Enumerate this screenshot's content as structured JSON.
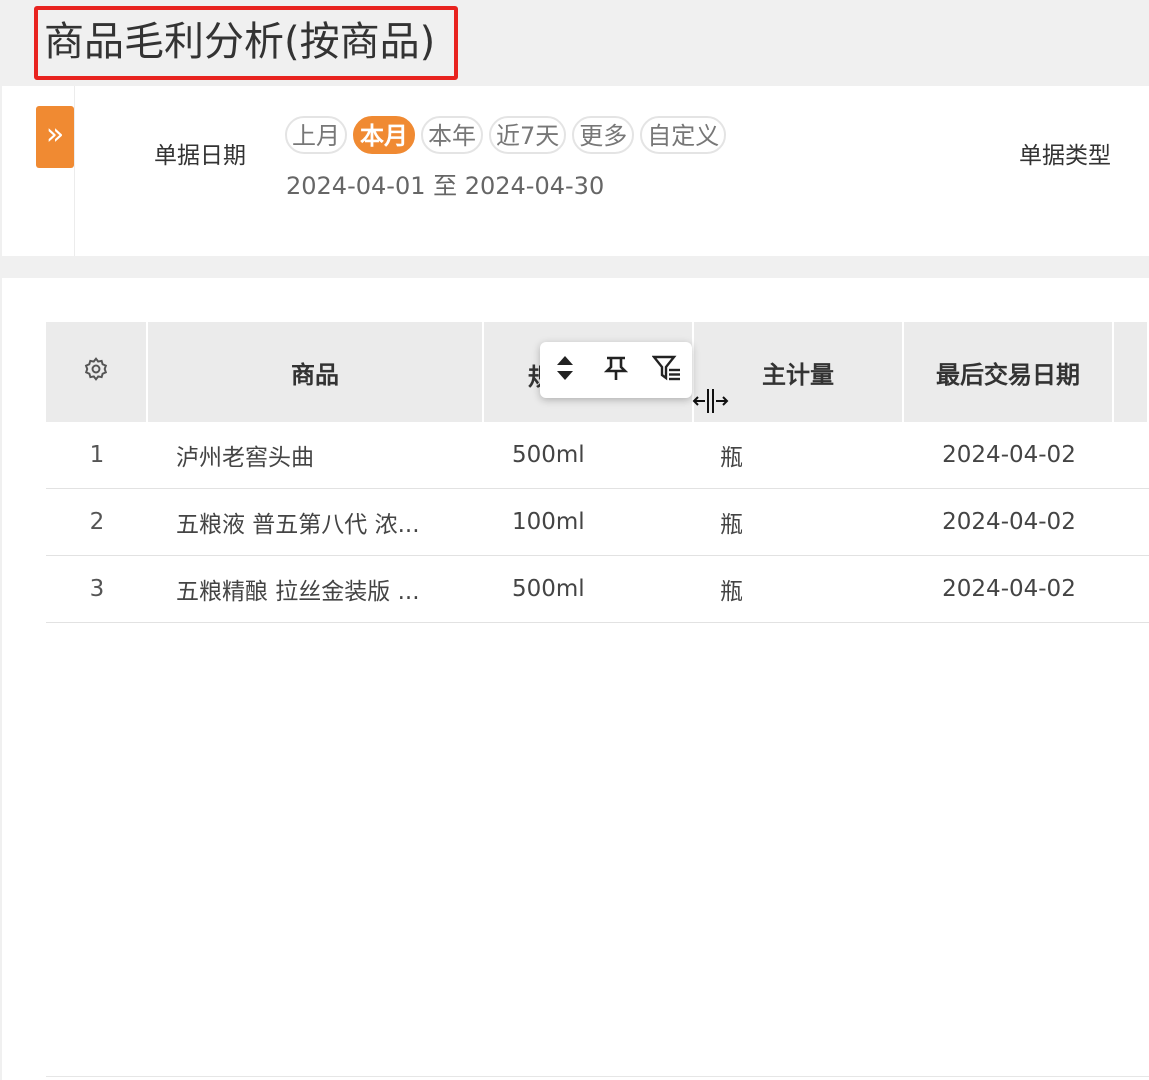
{
  "page": {
    "title": "商品毛利分析(按商品)"
  },
  "filter": {
    "expand_icon": "»",
    "date_label": "单据日期",
    "quick_ranges": [
      "上月",
      "本月",
      "本年",
      "近7天",
      "更多",
      "自定义"
    ],
    "active_range": "本月",
    "date_range_text": "2024-04-01 至 2024-04-30",
    "type_label": "单据类型"
  },
  "table": {
    "settings_icon": "gear-icon",
    "columns": [
      "商品",
      "规格",
      "主计量",
      "最后交易日期"
    ],
    "spec_header_fragment": "规",
    "rows": [
      {
        "index": "1",
        "product": "泸州老窖头曲",
        "spec": "500ml",
        "unit": "瓶",
        "last_trade_date": "2024-04-02"
      },
      {
        "index": "2",
        "product": "五粮液 普五第八代 浓...",
        "spec": "100ml",
        "unit": "瓶",
        "last_trade_date": "2024-04-02"
      },
      {
        "index": "3",
        "product": "五粮精酿 拉丝金装版 ...",
        "spec": "500ml",
        "unit": "瓶",
        "last_trade_date": "2024-04-02"
      }
    ]
  },
  "column_tools": {
    "icons": [
      "sort-icon",
      "pin-icon",
      "filter-icon"
    ]
  },
  "colors": {
    "accent": "#f08a32",
    "highlight_box": "#e8231f",
    "header_bg": "#ebebeb"
  }
}
